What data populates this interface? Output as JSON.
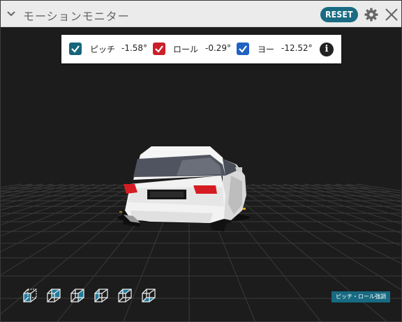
{
  "window": {
    "title": "モーションモニター",
    "reset_label": "RESET",
    "collapse_icon": "chevron-down-icon",
    "settings_icon": "gear-icon",
    "close_icon": "close-icon"
  },
  "readout": {
    "items": [
      {
        "label": "ピッチ",
        "value": "-1.58°",
        "checked": true,
        "color": "#17657a"
      },
      {
        "label": "ロール",
        "value": "-0.29°",
        "checked": true,
        "color": "#cc1f2a"
      },
      {
        "label": "ヨー",
        "value": "-12.52°",
        "checked": true,
        "color": "#1f63c2"
      }
    ],
    "info_label": "i",
    "info_icon": "info-icon"
  },
  "view_buttons": [
    {
      "icon": "cube-front-view-icon",
      "face_color": "#1f7a9a"
    },
    {
      "icon": "cube-back-view-icon",
      "face_color": "#1f7a9a"
    },
    {
      "icon": "cube-right-view-icon",
      "face_color": "#1f7a9a"
    },
    {
      "icon": "cube-left-view-icon",
      "face_color": "#1f7a9a"
    },
    {
      "icon": "cube-top-view-icon",
      "face_color": "#1f7a9a"
    },
    {
      "icon": "cube-bottom-view-icon",
      "face_color": "#1f7a9a"
    }
  ],
  "emphasis_button": {
    "label": "ピッチ・ロール強調",
    "color": "#176a82"
  },
  "scene": {
    "background": "#1c1c1c",
    "grid_color": "#3a3a3a",
    "vehicle": "white hatchback, rear view",
    "accent_color": "#e8a317"
  }
}
